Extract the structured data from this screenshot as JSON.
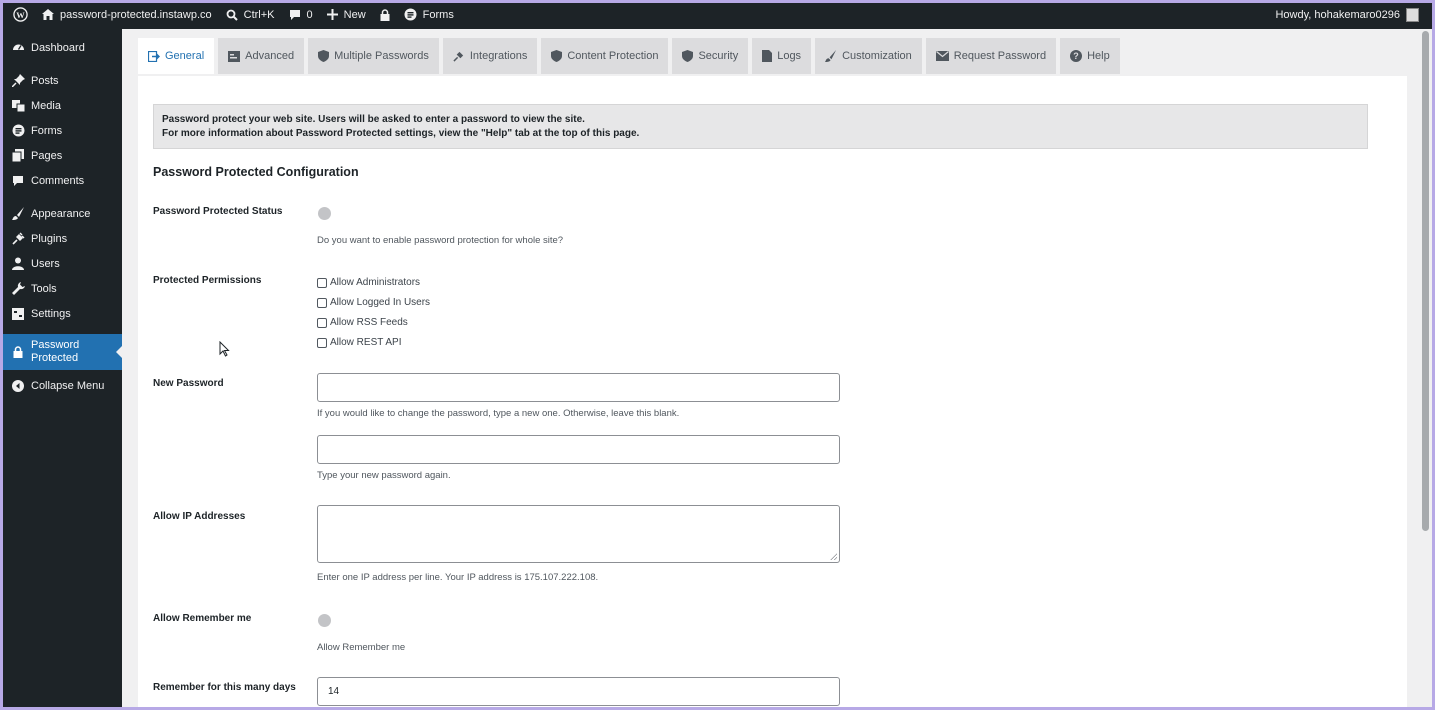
{
  "adminbar": {
    "site": "password-protected.instawp.co",
    "shortcut": "Ctrl+K",
    "comments_count": "0",
    "new": "New",
    "forms": "Forms",
    "howdy": "Howdy, hohakemaro0296"
  },
  "sidebar": {
    "items": [
      {
        "label": "Dashboard",
        "icon": "dashboard-icon"
      },
      {
        "label": "Posts",
        "icon": "pin-icon"
      },
      {
        "label": "Media",
        "icon": "media-icon"
      },
      {
        "label": "Forms",
        "icon": "forms-icon"
      },
      {
        "label": "Pages",
        "icon": "pages-icon"
      },
      {
        "label": "Comments",
        "icon": "comment-icon"
      },
      {
        "label": "Appearance",
        "icon": "brush-icon"
      },
      {
        "label": "Plugins",
        "icon": "plug-icon"
      },
      {
        "label": "Users",
        "icon": "user-icon"
      },
      {
        "label": "Tools",
        "icon": "wrench-icon"
      },
      {
        "label": "Settings",
        "icon": "settings-icon"
      },
      {
        "label": "Password",
        "label2": "Protected",
        "icon": "lock-icon"
      },
      {
        "label": "Collapse Menu",
        "icon": "collapse-icon"
      }
    ]
  },
  "tabs": [
    "General",
    "Advanced",
    "Multiple Passwords",
    "Integrations",
    "Content Protection",
    "Security",
    "Logs",
    "Customization",
    "Request Password",
    "Help"
  ],
  "notice": {
    "line1": "Password protect your web site. Users will be asked to enter a password to view the site.",
    "line2": "For more information about Password Protected settings, view the \"Help\" tab at the top of this page."
  },
  "form": {
    "title": "Password Protected Configuration",
    "status_label": "Password Protected Status",
    "status_desc": "Do you want to enable password protection for whole site?",
    "status_enabled": false,
    "permissions_label": "Protected Permissions",
    "permissions": [
      "Allow Administrators",
      "Allow Logged In Users",
      "Allow RSS Feeds",
      "Allow REST API"
    ],
    "new_password_label": "New Password",
    "new_password_value": "",
    "new_password_desc": "If you would like to change the password, type a new one. Otherwise, leave this blank.",
    "confirm_password_value": "",
    "confirm_password_desc": "Type your new password again.",
    "ip_label": "Allow IP Addresses",
    "ip_value": "",
    "ip_desc": "Enter one IP address per line. Your IP address is 175.107.222.108.",
    "remember_label": "Allow Remember me",
    "remember_desc": "Allow Remember me",
    "remember_enabled": false,
    "remember_days_label": "Remember for this many days",
    "remember_days_value": "14"
  },
  "colors": {
    "accent": "#2271b1",
    "adminbar": "#1d2327"
  }
}
